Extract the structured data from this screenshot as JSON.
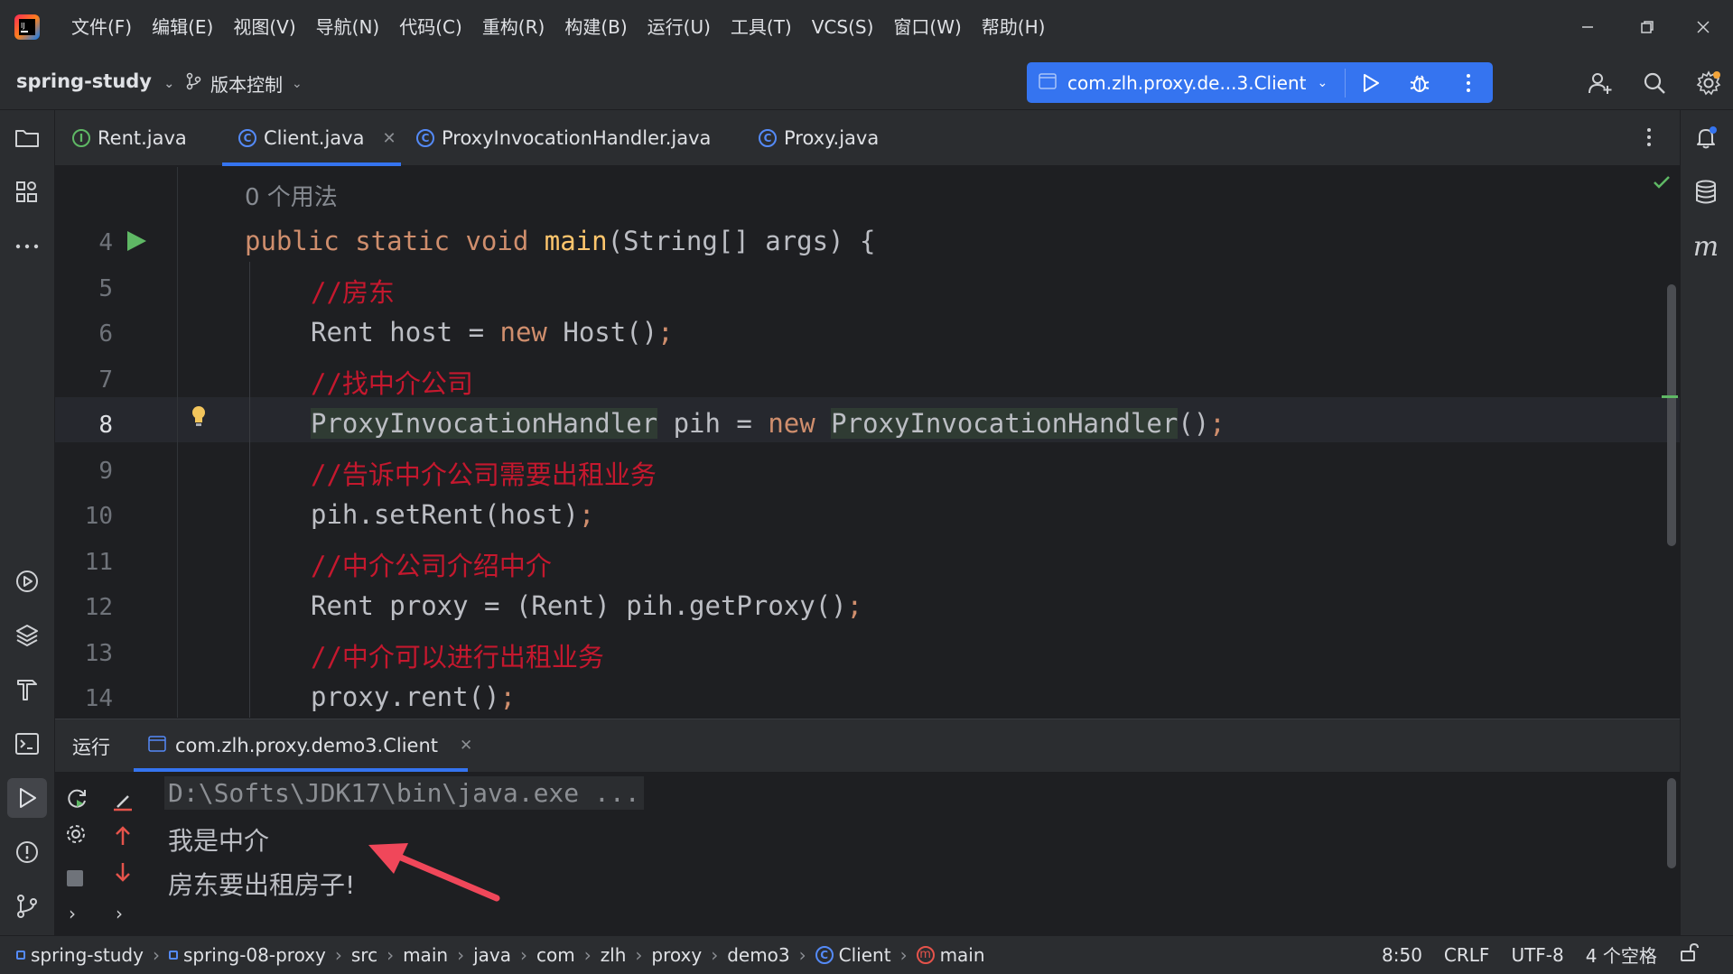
{
  "menu": [
    "文件(F)",
    "编辑(E)",
    "视图(V)",
    "导航(N)",
    "代码(C)",
    "重构(R)",
    "构建(B)",
    "运行(U)",
    "工具(T)",
    "VCS(S)",
    "窗口(W)",
    "帮助(H)"
  ],
  "toolbar": {
    "project": "spring-study",
    "vcs": "版本控制",
    "run_config": "com.zlh.proxy.de...3.Client"
  },
  "tabs": [
    {
      "label": "Rent.java",
      "icon": "interface-icon"
    },
    {
      "label": "Client.java",
      "icon": "class-icon",
      "active": true
    },
    {
      "label": "ProxyInvocationHandler.java",
      "icon": "class-icon"
    },
    {
      "label": "Proxy.java",
      "icon": "class-icon"
    }
  ],
  "editor": {
    "usages": "0 个用法",
    "lines": [
      {
        "num": "4",
        "parts": [
          [
            "kw",
            "public "
          ],
          [
            "kw",
            "static "
          ],
          [
            "kw",
            "void "
          ],
          [
            "fn-main",
            "main"
          ],
          [
            "",
            "(String[] args) {"
          ]
        ]
      },
      {
        "num": "5",
        "parts": [
          [
            "cmt",
            "//房东"
          ]
        ]
      },
      {
        "num": "6",
        "parts": [
          [
            "",
            "Rent host = "
          ],
          [
            "kw",
            "new "
          ],
          [
            "",
            "Host()"
          ],
          [
            "semi",
            ";"
          ]
        ]
      },
      {
        "num": "7",
        "parts": [
          [
            "cmt",
            "//找中介公司"
          ]
        ]
      },
      {
        "num": "8",
        "parts": [
          [
            "hlref",
            "ProxyInvocationHandler"
          ],
          [
            "",
            " pih = "
          ],
          [
            "kw",
            "new "
          ],
          [
            "hlref",
            "ProxyInvocationHandler"
          ],
          [
            "",
            "()"
          ],
          [
            "semi",
            ";"
          ]
        ]
      },
      {
        "num": "9",
        "parts": [
          [
            "cmt",
            "//告诉中介公司需要出租业务"
          ]
        ]
      },
      {
        "num": "10",
        "parts": [
          [
            "",
            "pih.setRent(host)"
          ],
          [
            "semi",
            ";"
          ]
        ]
      },
      {
        "num": "11",
        "parts": [
          [
            "cmt",
            "//中介公司介绍中介"
          ]
        ]
      },
      {
        "num": "12",
        "parts": [
          [
            "",
            "Rent proxy = (Rent) pih.getProxy()"
          ],
          [
            "semi",
            ";"
          ]
        ]
      },
      {
        "num": "13",
        "parts": [
          [
            "cmt",
            "//中介可以进行出租业务"
          ]
        ]
      },
      {
        "num": "14",
        "parts": [
          [
            "",
            "proxy.rent()"
          ],
          [
            "semi",
            ";"
          ]
        ]
      }
    ]
  },
  "run": {
    "title": "运行",
    "tab": "com.zlh.proxy.demo3.Client",
    "output": [
      "D:\\Softs\\JDK17\\bin\\java.exe ...",
      "我是中介",
      "房东要出租房子!"
    ]
  },
  "breadcrumbs": [
    "spring-study",
    "spring-08-proxy",
    "src",
    "main",
    "java",
    "com",
    "zlh",
    "proxy",
    "demo3",
    "Client",
    "main"
  ],
  "status": {
    "position": "8:50",
    "line_sep": "CRLF",
    "encoding": "UTF-8",
    "indent": "4 个空格"
  }
}
